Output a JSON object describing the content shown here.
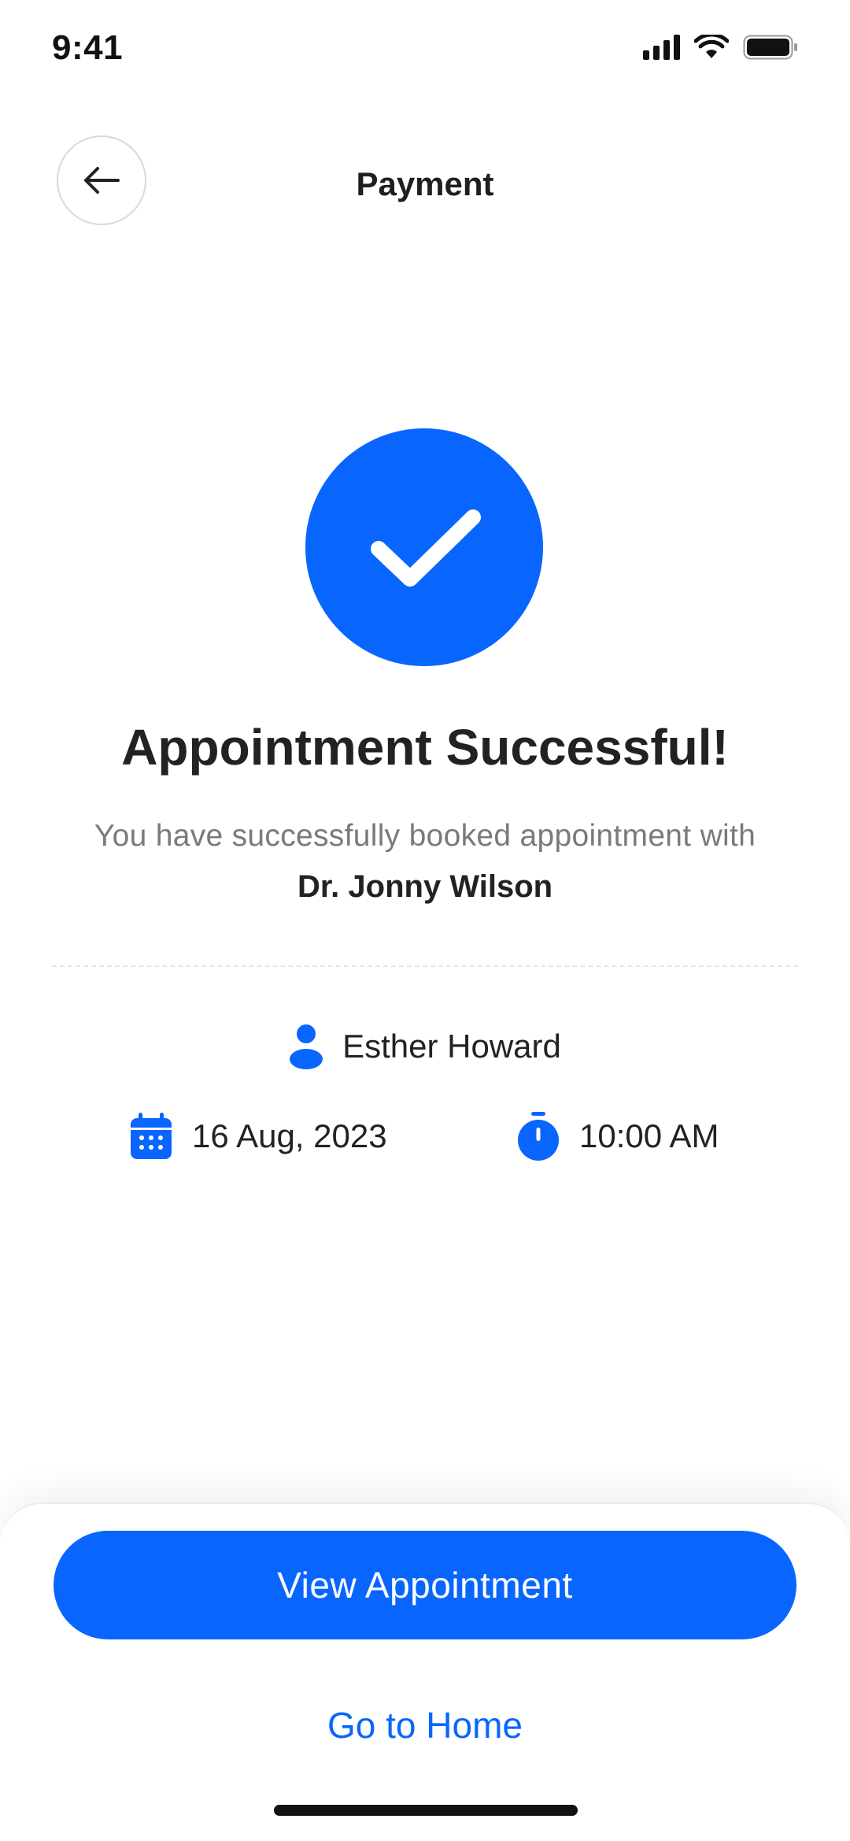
{
  "status_bar": {
    "time": "9:41",
    "icons": [
      "signal-icon",
      "wifi-icon",
      "battery-icon"
    ]
  },
  "header": {
    "title": "Payment",
    "back_icon": "arrow-left-icon"
  },
  "success": {
    "icon": "checkmark-icon",
    "headline": "Appointment Successful!",
    "message": "You have successfully booked appointment with",
    "doctor_name": "Dr. Jonny Wilson"
  },
  "details": {
    "patient_icon": "person-icon",
    "patient_name": "Esther Howard",
    "date_icon": "calendar-icon",
    "date": "16 Aug, 2023",
    "time_icon": "stopwatch-icon",
    "time": "10:00 AM"
  },
  "actions": {
    "primary_label": "View Appointment",
    "secondary_label": "Go to Home"
  },
  "colors": {
    "accent": "#0866ff",
    "text_primary": "#222222",
    "text_secondary": "#7a7a7a"
  }
}
